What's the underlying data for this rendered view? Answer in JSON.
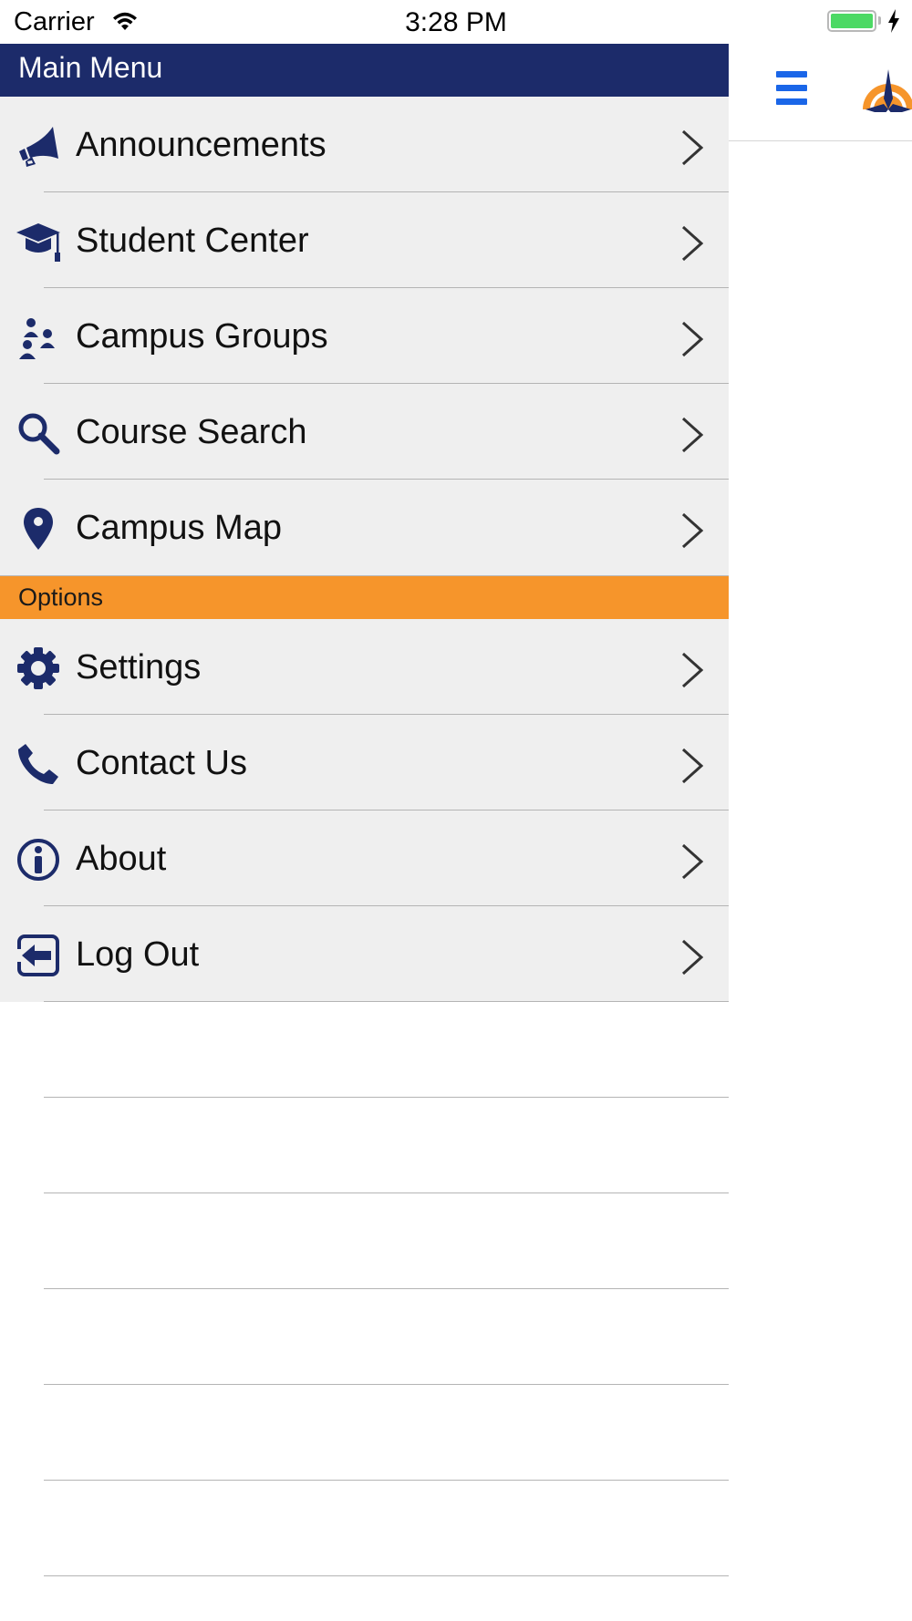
{
  "status_bar": {
    "carrier": "Carrier",
    "time": "3:28 PM"
  },
  "colors": {
    "navy": "#1c2b6a",
    "orange": "#f6952b",
    "accent_blue": "#1a66e8",
    "row_bg": "#efefef"
  },
  "drawer": {
    "main_header": "Main  Menu",
    "main_items": [
      {
        "label": "Announcements",
        "icon": "megaphone-icon"
      },
      {
        "label": "Student Center",
        "icon": "graduation-cap-icon"
      },
      {
        "label": "Campus Groups",
        "icon": "users-group-icon"
      },
      {
        "label": "Course Search",
        "icon": "search-icon"
      },
      {
        "label": "Campus Map",
        "icon": "map-pin-icon"
      }
    ],
    "options_header": "Options",
    "option_items": [
      {
        "label": "Settings",
        "icon": "gear-icon"
      },
      {
        "label": "Contact Us",
        "icon": "phone-icon"
      },
      {
        "label": "About",
        "icon": "info-icon"
      },
      {
        "label": "Log Out",
        "icon": "log-out-icon"
      }
    ]
  },
  "behind": {
    "menu_icon": "hamburger-menu-icon",
    "logo_icon": "compass-sun-logo-icon"
  }
}
